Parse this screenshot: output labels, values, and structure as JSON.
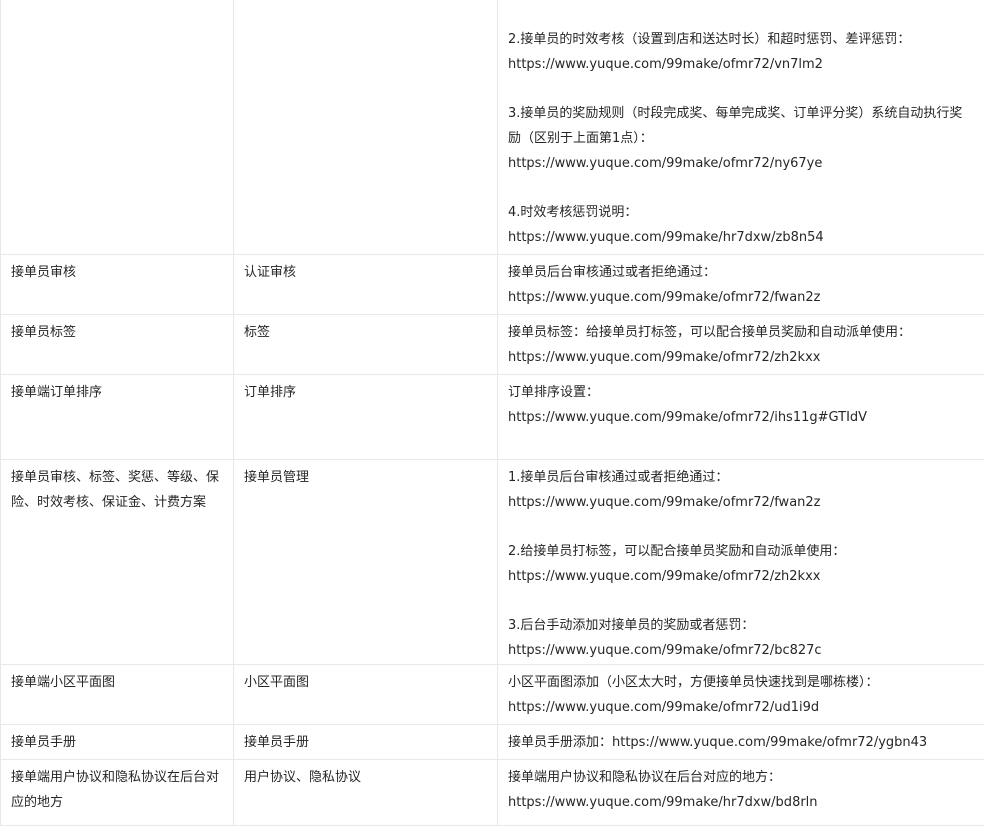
{
  "rows": [
    {
      "c1": "",
      "c2": "",
      "c3": [
        "2.接单员的时效考核（设置到店和送达时长）和超时惩罚、差评惩罚：",
        "https://www.yuque.com/99make/ofmr72/vn7lm2",
        "",
        "3.接单员的奖励规则（时段完成奖、每单完成奖、订单评分奖）系统自动执行奖励（区别于上面第1点）：",
        "https://www.yuque.com/99make/ofmr72/ny67ye",
        "",
        "4.时效考核惩罚说明：",
        "https://www.yuque.com/99make/hr7dxw/zb8n54"
      ]
    },
    {
      "c1": "接单员审核",
      "c2": "认证审核",
      "c3": [
        "接单员后台审核通过或者拒绝通过：",
        "https://www.yuque.com/99make/ofmr72/fwan2z"
      ]
    },
    {
      "c1": "接单员标签",
      "c2": "标签",
      "c3": [
        "接单员标签：给接单员打标签，可以配合接单员奖励和自动派单使用：",
        "https://www.yuque.com/99make/ofmr72/zh2kxx"
      ]
    },
    {
      "c1": "接单端订单排序",
      "c2": "订单排序",
      "c3": [
        "订单排序设置：",
        "https://www.yuque.com/99make/ofmr72/ihs11g#GTIdV"
      ]
    },
    {
      "c1": "接单员审核、标签、奖惩、等级、保险、时效考核、保证金、计费方案",
      "c2": "接单员管理",
      "c3": [
        "1.接单员后台审核通过或者拒绝通过：",
        "https://www.yuque.com/99make/ofmr72/fwan2z",
        "",
        "2.给接单员打标签，可以配合接单员奖励和自动派单使用：",
        "https://www.yuque.com/99make/ofmr72/zh2kxx",
        "",
        "3.后台手动添加对接单员的奖励或者惩罚：",
        "https://www.yuque.com/99make/ofmr72/bc827c"
      ]
    },
    {
      "c1": "接单端小区平面图",
      "c2": "小区平面图",
      "c3": [
        "小区平面图添加（小区太大时，方便接单员快速找到是哪栋楼）：",
        "https://www.yuque.com/99make/ofmr72/ud1i9d"
      ]
    },
    {
      "c1": "接单员手册",
      "c2": "接单员手册",
      "c3": [
        "接单员手册添加：https://www.yuque.com/99make/ofmr72/ygbn43"
      ]
    },
    {
      "c1": "接单端用户协议和隐私协议在后台对应的地方",
      "c2": "用户协议、隐私协议",
      "c3": [
        "接单端用户协议和隐私协议在后台对应的地方：",
        "https://www.yuque.com/99make/hr7dxw/bd8rln"
      ]
    }
  ]
}
